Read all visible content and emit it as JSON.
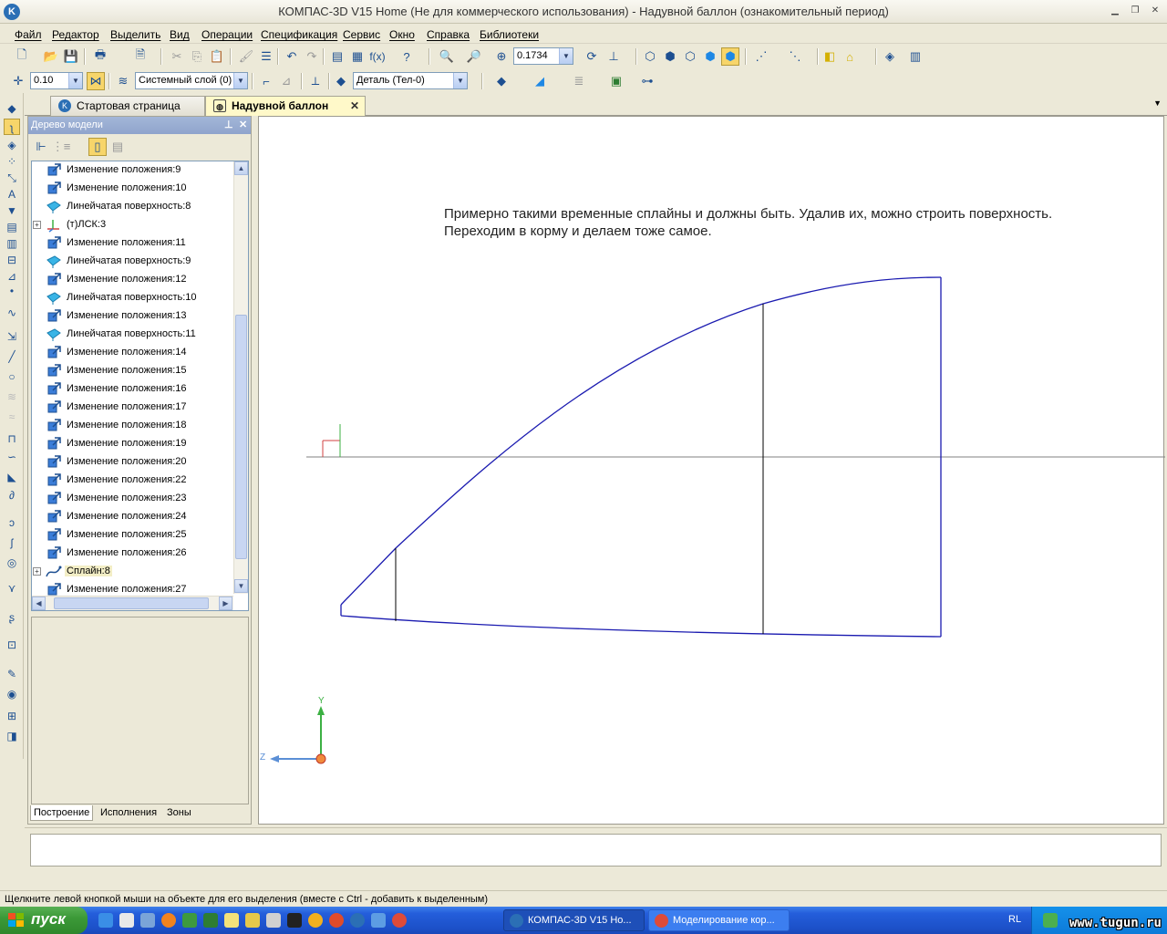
{
  "window": {
    "title": "КОМПАС-3D V15 Home (Не для коммерческого использования) - Надувной баллон (ознакомительный период)",
    "icon_label": "K"
  },
  "menu": [
    "Файл",
    "Редактор",
    "Выделить",
    "Вид",
    "Операции",
    "Спецификация",
    "Сервис",
    "Окно",
    "Справка",
    "Библиотеки"
  ],
  "toolbar": {
    "zoom_value": "0.1734",
    "step_value": "0.10",
    "layer_value": "Системный слой (0)",
    "part_value": "Деталь (Тел-0)"
  },
  "tabs": [
    {
      "label": "Стартовая страница"
    },
    {
      "label": "Надувной баллон",
      "close": "✕"
    }
  ],
  "model_tree": {
    "title": "Дерево модели",
    "items": [
      {
        "label": "Изменение положения:9",
        "icon": "move-icon"
      },
      {
        "label": "Изменение положения:10",
        "icon": "move-icon"
      },
      {
        "label": "Линейчатая поверхность:8",
        "icon": "surface-icon"
      },
      {
        "label": "(т)ЛСК:3",
        "icon": "lcs-icon",
        "expandable": true
      },
      {
        "label": "Изменение положения:11",
        "icon": "move-icon"
      },
      {
        "label": "Линейчатая поверхность:9",
        "icon": "surface-icon"
      },
      {
        "label": "Изменение положения:12",
        "icon": "move-icon"
      },
      {
        "label": "Линейчатая поверхность:10",
        "icon": "surface-icon"
      },
      {
        "label": "Изменение положения:13",
        "icon": "move-icon"
      },
      {
        "label": "Линейчатая поверхность:11",
        "icon": "surface-icon"
      },
      {
        "label": "Изменение положения:14",
        "icon": "move-icon"
      },
      {
        "label": "Изменение положения:15",
        "icon": "move-icon"
      },
      {
        "label": "Изменение положения:16",
        "icon": "move-icon"
      },
      {
        "label": "Изменение положения:17",
        "icon": "move-icon"
      },
      {
        "label": "Изменение положения:18",
        "icon": "move-icon"
      },
      {
        "label": "Изменение положения:19",
        "icon": "move-icon"
      },
      {
        "label": "Изменение положения:20",
        "icon": "move-icon"
      },
      {
        "label": "Изменение положения:22",
        "icon": "move-icon"
      },
      {
        "label": "Изменение положения:23",
        "icon": "move-icon"
      },
      {
        "label": "Изменение положения:24",
        "icon": "move-icon"
      },
      {
        "label": "Изменение положения:25",
        "icon": "move-icon"
      },
      {
        "label": "Изменение положения:26",
        "icon": "move-icon"
      },
      {
        "label": "Сплайн:8",
        "icon": "spline-icon",
        "expandable": true,
        "selected": true
      },
      {
        "label": "Изменение положения:27",
        "icon": "move-icon"
      }
    ],
    "bottom_tabs": [
      "Построение",
      "Исполнения",
      "Зоны"
    ]
  },
  "canvas": {
    "note_line1": "Примерно такими временные сплайны и должны быть.  Удалив их, можно строить поверхность.",
    "note_line2": "Переходим в корму и делаем тоже самое.",
    "axis_y": "Y",
    "axis_z": "Z"
  },
  "status": "Щелкните левой кнопкой мыши на объекте для его выделения (вместе с Ctrl - добавить к выделенным)",
  "taskbar": {
    "start": "пуск",
    "tasks": [
      {
        "label": "КОМПАС-3D V15 Ho..."
      },
      {
        "label": "Моделирование кор..."
      }
    ],
    "lang": "RL",
    "watermark": "www.tugun.ru"
  },
  "colors": {
    "spline": "#1a1ab0",
    "active_tab": "#fff9c9",
    "taskbar": "#245edb"
  }
}
